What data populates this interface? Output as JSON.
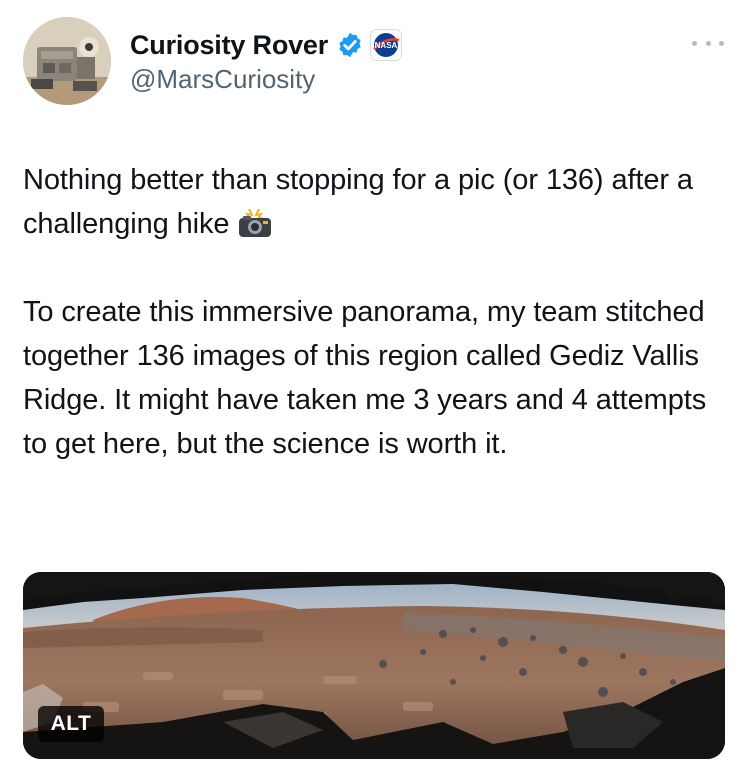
{
  "tweet": {
    "author": {
      "display_name": "Curiosity Rover",
      "handle": "@MarsCuriosity",
      "verified_icon": "verified-badge-icon",
      "affiliate_logo": "nasa-logo"
    },
    "more_icon": "more-options-icon",
    "text": {
      "paragraph_1": "Nothing better than stopping for a pic (or 136) after a challenging hike",
      "paragraph_1_emoji": "camera-flash-icon",
      "paragraph_2": "To create this immersive panorama, my team stitched together 136 images of this region called Gediz Vallis Ridge. It might have taken me 3 years and 4 attempts to get here, but the science is worth it."
    },
    "media": {
      "alt_label": "ALT"
    }
  },
  "colors": {
    "text": "#0f1419",
    "secondary": "#536471",
    "verified": "#1d9bf0",
    "nasa_blue": "#0b3d91",
    "nasa_red": "#fc3d21"
  }
}
